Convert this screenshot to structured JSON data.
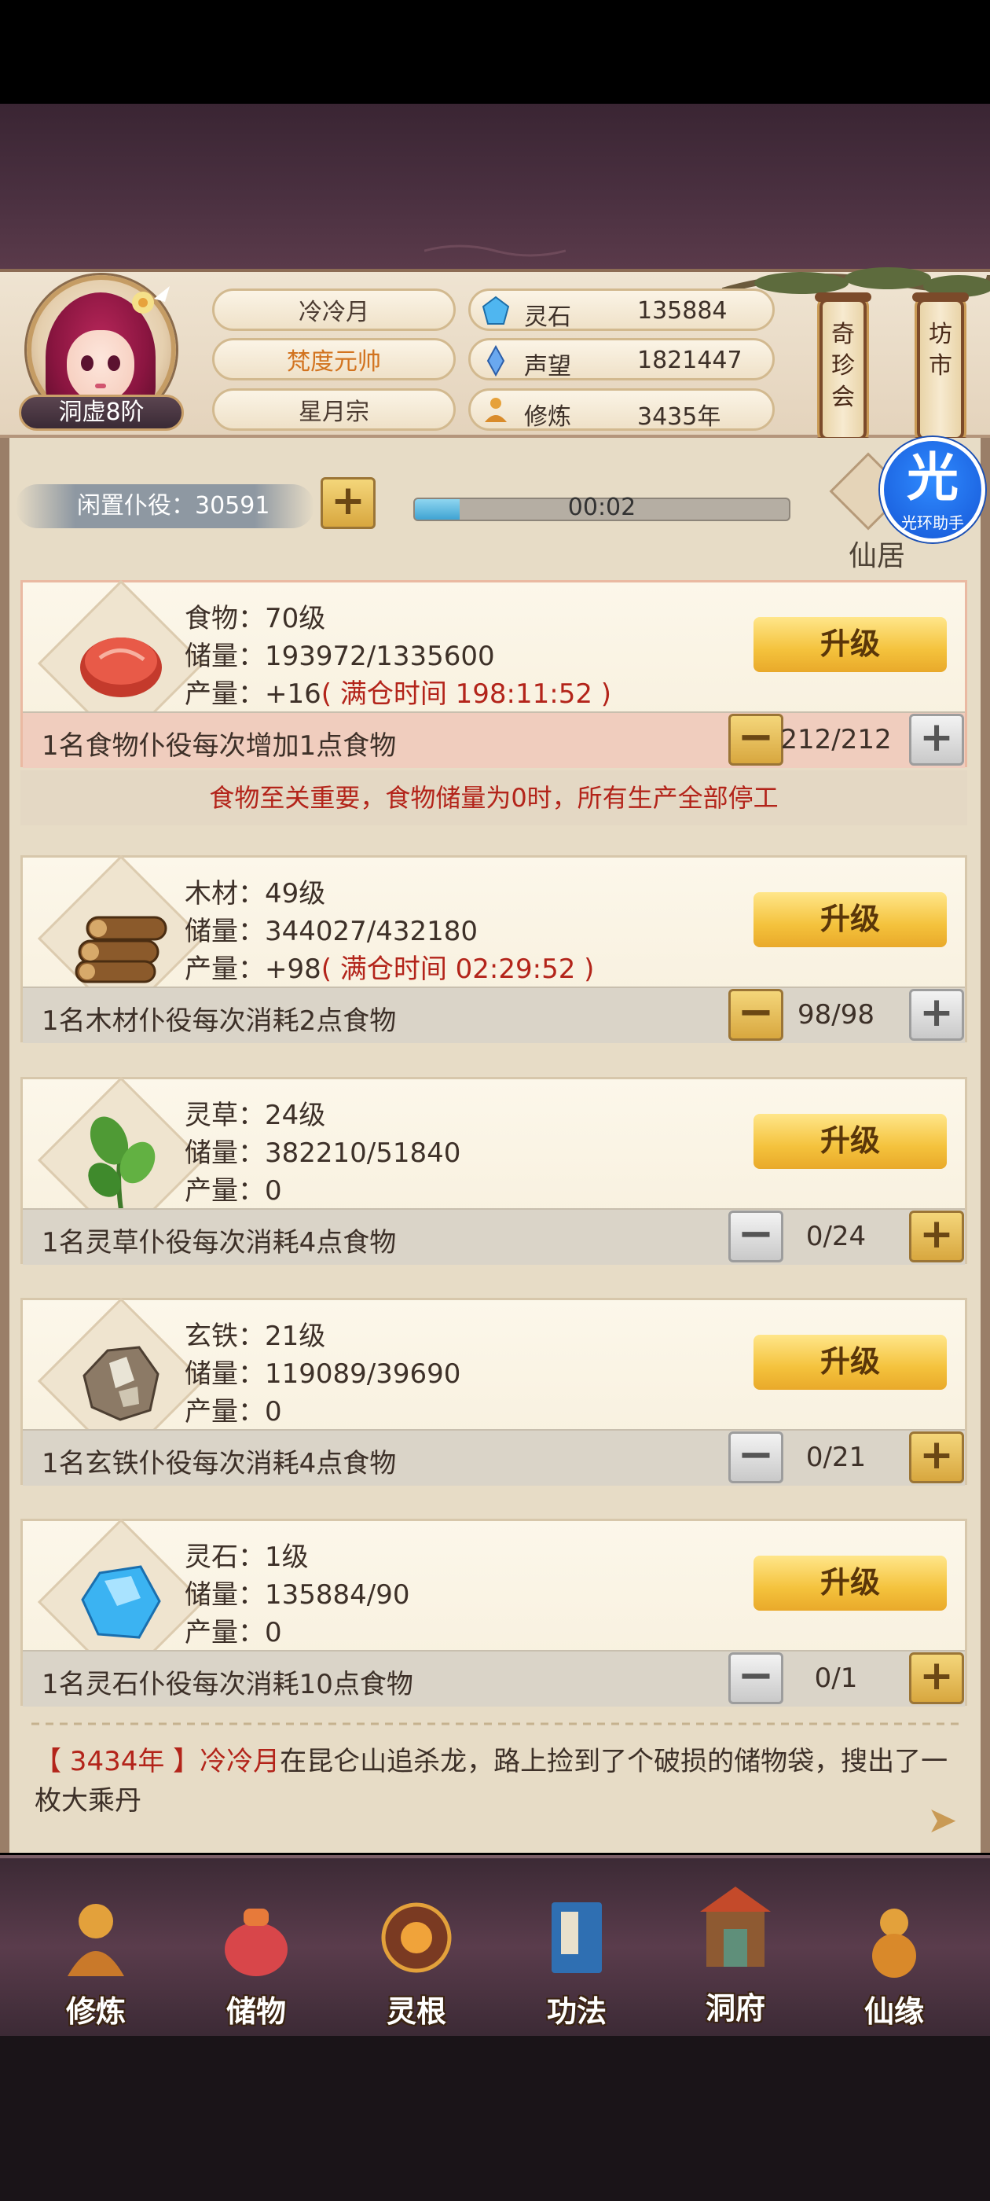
{
  "player": {
    "name": "冷冷月",
    "title": "梵度元帅",
    "sect": "星月宗",
    "rank": "洞虚8阶"
  },
  "stats": [
    {
      "label": "灵石",
      "value": "135884",
      "icon": "spirit-stone-icon"
    },
    {
      "label": "声望",
      "value": "1821447",
      "icon": "reputation-icon"
    },
    {
      "label": "修炼",
      "value": "3435年",
      "icon": "meditation-icon"
    }
  ],
  "shops": {
    "treasure": "奇珍会",
    "market": "坊市"
  },
  "idle": {
    "label": "闲置仆役：30591",
    "timer": "00:02",
    "progress": 0.12
  },
  "residence": "仙居",
  "helper": {
    "big": "光",
    "small": "光环助手"
  },
  "upgrade_label": "升级",
  "resources": [
    {
      "name_line": "食物：70级",
      "storage_line": "储量：193972/1335600",
      "output_prefix": "产量：+16",
      "output_note": "( 满仓时间 198:11:52 )",
      "footer": "1名食物仆役每次增加1点食物",
      "count": "212/212",
      "icon": "meat-icon"
    },
    {
      "name_line": "木材：49级",
      "storage_line": "储量：344027/432180",
      "output_prefix": "产量：+98",
      "output_note": "( 满仓时间 02:29:52 )",
      "footer": "1名木材仆役每次消耗2点食物",
      "count": "98/98",
      "icon": "wood-logs-icon"
    },
    {
      "name_line": "灵草：24级",
      "storage_line": "储量：382210/51840",
      "output_prefix": "产量：0",
      "output_note": "",
      "footer": "1名灵草仆役每次消耗4点食物",
      "count": "0/24",
      "icon": "herb-icon"
    },
    {
      "name_line": "玄铁：21级",
      "storage_line": "储量：119089/39690",
      "output_prefix": "产量：0",
      "output_note": "",
      "footer": "1名玄铁仆役每次消耗4点食物",
      "count": "0/21",
      "icon": "ore-icon"
    },
    {
      "name_line": "灵石：1级",
      "storage_line": "储量：135884/90",
      "output_prefix": "产量：0",
      "output_note": "",
      "footer": "1名灵石仆役每次消耗10点食物",
      "count": "0/1",
      "icon": "spirit-crystal-icon"
    }
  ],
  "warning": "食物至关重要，食物储量为0时，所有生产全部停工",
  "log": {
    "year": "【 3434年 】",
    "name": "冷冷月",
    "text": "在昆仑山追杀龙，路上捡到了个破损的储物袋，搜出了一枚大乘丹"
  },
  "nav": [
    {
      "label": "修炼",
      "icon": "cultivation-icon"
    },
    {
      "label": "储物",
      "icon": "storage-bag-icon"
    },
    {
      "label": "灵根",
      "icon": "spirit-root-icon"
    },
    {
      "label": "功法",
      "icon": "scripture-book-icon"
    },
    {
      "label": "洞府",
      "icon": "cave-mansion-icon"
    },
    {
      "label": "仙缘",
      "icon": "gourd-icon"
    }
  ],
  "colors": {
    "accent_gold": "#f4c23c",
    "warning_red": "#b3241a",
    "panel": "#fcf7ea"
  }
}
